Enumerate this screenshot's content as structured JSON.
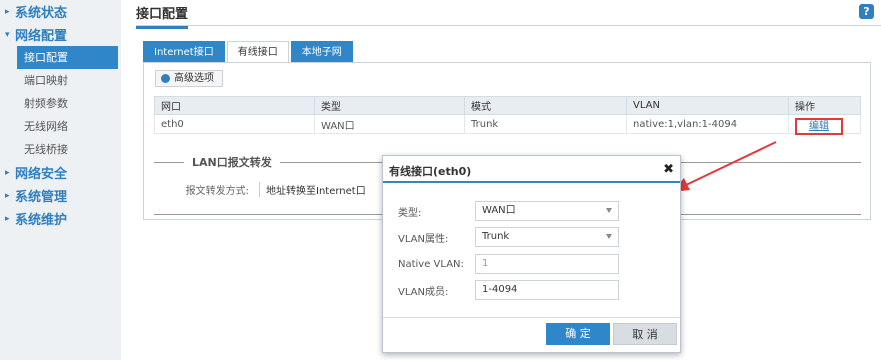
{
  "sidebar": {
    "groups": [
      {
        "label": "系统状态"
      },
      {
        "label": "网络配置"
      },
      {
        "label": "网络安全"
      },
      {
        "label": "系统管理"
      },
      {
        "label": "系统维护"
      }
    ],
    "sub_items": [
      {
        "label": "接口配置"
      },
      {
        "label": "端口映射"
      },
      {
        "label": "射频参数"
      },
      {
        "label": "无线网络"
      },
      {
        "label": "无线桥接"
      }
    ]
  },
  "header": {
    "title": "接口配置",
    "help": "?"
  },
  "tabs": [
    {
      "label": "Internet接口"
    },
    {
      "label": "有线接口"
    },
    {
      "label": "本地子网"
    }
  ],
  "toolbar": {
    "advanced_label": "高级选项"
  },
  "table": {
    "headers": [
      "网口",
      "类型",
      "模式",
      "VLAN",
      "操作"
    ],
    "rows": [
      {
        "port": "eth0",
        "type": "WAN口",
        "mode": "Trunk",
        "vlan": "native:1,vlan:1-4094",
        "action": "编辑"
      }
    ]
  },
  "lan_section": {
    "title": "LAN口报文转发",
    "label": "报文转发方式:",
    "value": "地址转换至Internet口"
  },
  "modal": {
    "title": "有线接口(eth0)",
    "close": "✖",
    "fields": {
      "type_label": "类型:",
      "type_value": "WAN口",
      "vlan_attr_label": "VLAN属性:",
      "vlan_attr_value": "Trunk",
      "native_label": "Native VLAN:",
      "native_value": "1",
      "members_label": "VLAN成员:",
      "members_value": "1-4094"
    },
    "ok_label": "确 定",
    "cancel_label": "取 消"
  },
  "colors": {
    "accent": "#2f86c8",
    "highlight": "#e23a3a"
  }
}
